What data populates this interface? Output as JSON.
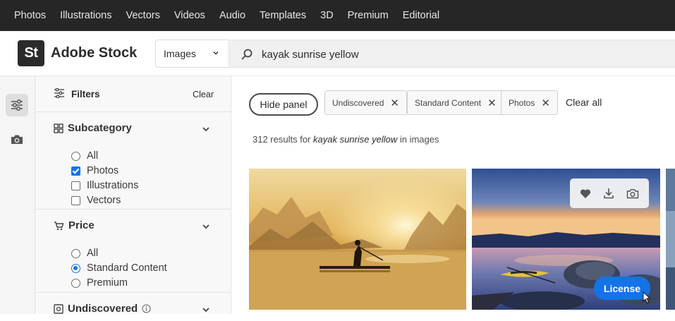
{
  "topnav": {
    "items": [
      {
        "label": "Photos"
      },
      {
        "label": "Illustrations"
      },
      {
        "label": "Vectors"
      },
      {
        "label": "Videos"
      },
      {
        "label": "Audio"
      },
      {
        "label": "Templates"
      },
      {
        "label": "3D"
      },
      {
        "label": "Premium"
      },
      {
        "label": "Editorial"
      }
    ]
  },
  "header": {
    "logo_mark": "St",
    "logo_text": "Adobe Stock",
    "search_type": "Images",
    "search_query": "kayak sunrise yellow",
    "search_icon": "search-icon",
    "chevron_icon": "chevron-down-icon"
  },
  "rail": {
    "items": [
      {
        "icon": "sliders-icon",
        "active": true
      },
      {
        "icon": "camera-icon",
        "active": false
      }
    ]
  },
  "filters": {
    "title": "Filters",
    "clear_label": "Clear",
    "subcategory": {
      "title": "Subcategory",
      "options": [
        {
          "label": "All",
          "checked": false
        },
        {
          "label": "Photos",
          "checked": true
        },
        {
          "label": "Illustrations",
          "checked": false
        },
        {
          "label": "Vectors",
          "checked": false
        }
      ]
    },
    "price": {
      "title": "Price",
      "options": [
        {
          "label": "All",
          "selected": false
        },
        {
          "label": "Standard Content",
          "selected": true
        },
        {
          "label": "Premium",
          "selected": false
        }
      ]
    },
    "undiscovered": {
      "title": "Undiscovered"
    }
  },
  "toolbar": {
    "hide_panel_label": "Hide panel",
    "chips": [
      {
        "label": "Undiscovered"
      },
      {
        "label": "Standard Content"
      },
      {
        "label": "Photos"
      }
    ],
    "clear_all_label": "Clear all"
  },
  "results": {
    "count_prefix": "312 results for",
    "query": "kayak sunrise yellow",
    "suffix": "in images"
  },
  "image_card": {
    "license_label": "License",
    "actions": [
      "heart-icon",
      "download-icon",
      "find-similar-icon"
    ]
  },
  "colors": {
    "accent": "#1473e6",
    "topnav_bg": "#262626",
    "logo_bg": "#2b2b2b"
  }
}
